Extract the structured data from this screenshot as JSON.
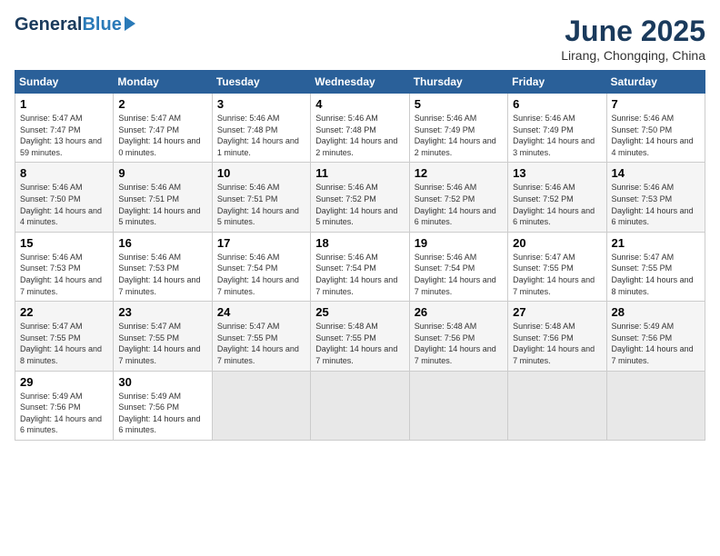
{
  "header": {
    "logo_general": "General",
    "logo_blue": "Blue",
    "month_title": "June 2025",
    "location": "Lirang, Chongqing, China"
  },
  "columns": [
    "Sunday",
    "Monday",
    "Tuesday",
    "Wednesday",
    "Thursday",
    "Friday",
    "Saturday"
  ],
  "weeks": [
    [
      {
        "day": "1",
        "sunrise": "Sunrise: 5:47 AM",
        "sunset": "Sunset: 7:47 PM",
        "daylight": "Daylight: 13 hours and 59 minutes."
      },
      {
        "day": "2",
        "sunrise": "Sunrise: 5:47 AM",
        "sunset": "Sunset: 7:47 PM",
        "daylight": "Daylight: 14 hours and 0 minutes."
      },
      {
        "day": "3",
        "sunrise": "Sunrise: 5:46 AM",
        "sunset": "Sunset: 7:48 PM",
        "daylight": "Daylight: 14 hours and 1 minute."
      },
      {
        "day": "4",
        "sunrise": "Sunrise: 5:46 AM",
        "sunset": "Sunset: 7:48 PM",
        "daylight": "Daylight: 14 hours and 2 minutes."
      },
      {
        "day": "5",
        "sunrise": "Sunrise: 5:46 AM",
        "sunset": "Sunset: 7:49 PM",
        "daylight": "Daylight: 14 hours and 2 minutes."
      },
      {
        "day": "6",
        "sunrise": "Sunrise: 5:46 AM",
        "sunset": "Sunset: 7:49 PM",
        "daylight": "Daylight: 14 hours and 3 minutes."
      },
      {
        "day": "7",
        "sunrise": "Sunrise: 5:46 AM",
        "sunset": "Sunset: 7:50 PM",
        "daylight": "Daylight: 14 hours and 4 minutes."
      }
    ],
    [
      {
        "day": "8",
        "sunrise": "Sunrise: 5:46 AM",
        "sunset": "Sunset: 7:50 PM",
        "daylight": "Daylight: 14 hours and 4 minutes."
      },
      {
        "day": "9",
        "sunrise": "Sunrise: 5:46 AM",
        "sunset": "Sunset: 7:51 PM",
        "daylight": "Daylight: 14 hours and 5 minutes."
      },
      {
        "day": "10",
        "sunrise": "Sunrise: 5:46 AM",
        "sunset": "Sunset: 7:51 PM",
        "daylight": "Daylight: 14 hours and 5 minutes."
      },
      {
        "day": "11",
        "sunrise": "Sunrise: 5:46 AM",
        "sunset": "Sunset: 7:52 PM",
        "daylight": "Daylight: 14 hours and 5 minutes."
      },
      {
        "day": "12",
        "sunrise": "Sunrise: 5:46 AM",
        "sunset": "Sunset: 7:52 PM",
        "daylight": "Daylight: 14 hours and 6 minutes."
      },
      {
        "day": "13",
        "sunrise": "Sunrise: 5:46 AM",
        "sunset": "Sunset: 7:52 PM",
        "daylight": "Daylight: 14 hours and 6 minutes."
      },
      {
        "day": "14",
        "sunrise": "Sunrise: 5:46 AM",
        "sunset": "Sunset: 7:53 PM",
        "daylight": "Daylight: 14 hours and 6 minutes."
      }
    ],
    [
      {
        "day": "15",
        "sunrise": "Sunrise: 5:46 AM",
        "sunset": "Sunset: 7:53 PM",
        "daylight": "Daylight: 14 hours and 7 minutes."
      },
      {
        "day": "16",
        "sunrise": "Sunrise: 5:46 AM",
        "sunset": "Sunset: 7:53 PM",
        "daylight": "Daylight: 14 hours and 7 minutes."
      },
      {
        "day": "17",
        "sunrise": "Sunrise: 5:46 AM",
        "sunset": "Sunset: 7:54 PM",
        "daylight": "Daylight: 14 hours and 7 minutes."
      },
      {
        "day": "18",
        "sunrise": "Sunrise: 5:46 AM",
        "sunset": "Sunset: 7:54 PM",
        "daylight": "Daylight: 14 hours and 7 minutes."
      },
      {
        "day": "19",
        "sunrise": "Sunrise: 5:46 AM",
        "sunset": "Sunset: 7:54 PM",
        "daylight": "Daylight: 14 hours and 7 minutes."
      },
      {
        "day": "20",
        "sunrise": "Sunrise: 5:47 AM",
        "sunset": "Sunset: 7:55 PM",
        "daylight": "Daylight: 14 hours and 7 minutes."
      },
      {
        "day": "21",
        "sunrise": "Sunrise: 5:47 AM",
        "sunset": "Sunset: 7:55 PM",
        "daylight": "Daylight: 14 hours and 8 minutes."
      }
    ],
    [
      {
        "day": "22",
        "sunrise": "Sunrise: 5:47 AM",
        "sunset": "Sunset: 7:55 PM",
        "daylight": "Daylight: 14 hours and 8 minutes."
      },
      {
        "day": "23",
        "sunrise": "Sunrise: 5:47 AM",
        "sunset": "Sunset: 7:55 PM",
        "daylight": "Daylight: 14 hours and 7 minutes."
      },
      {
        "day": "24",
        "sunrise": "Sunrise: 5:47 AM",
        "sunset": "Sunset: 7:55 PM",
        "daylight": "Daylight: 14 hours and 7 minutes."
      },
      {
        "day": "25",
        "sunrise": "Sunrise: 5:48 AM",
        "sunset": "Sunset: 7:55 PM",
        "daylight": "Daylight: 14 hours and 7 minutes."
      },
      {
        "day": "26",
        "sunrise": "Sunrise: 5:48 AM",
        "sunset": "Sunset: 7:56 PM",
        "daylight": "Daylight: 14 hours and 7 minutes."
      },
      {
        "day": "27",
        "sunrise": "Sunrise: 5:48 AM",
        "sunset": "Sunset: 7:56 PM",
        "daylight": "Daylight: 14 hours and 7 minutes."
      },
      {
        "day": "28",
        "sunrise": "Sunrise: 5:49 AM",
        "sunset": "Sunset: 7:56 PM",
        "daylight": "Daylight: 14 hours and 7 minutes."
      }
    ],
    [
      {
        "day": "29",
        "sunrise": "Sunrise: 5:49 AM",
        "sunset": "Sunset: 7:56 PM",
        "daylight": "Daylight: 14 hours and 6 minutes."
      },
      {
        "day": "30",
        "sunrise": "Sunrise: 5:49 AM",
        "sunset": "Sunset: 7:56 PM",
        "daylight": "Daylight: 14 hours and 6 minutes."
      },
      {
        "day": "",
        "sunrise": "",
        "sunset": "",
        "daylight": ""
      },
      {
        "day": "",
        "sunrise": "",
        "sunset": "",
        "daylight": ""
      },
      {
        "day": "",
        "sunrise": "",
        "sunset": "",
        "daylight": ""
      },
      {
        "day": "",
        "sunrise": "",
        "sunset": "",
        "daylight": ""
      },
      {
        "day": "",
        "sunrise": "",
        "sunset": "",
        "daylight": ""
      }
    ]
  ]
}
